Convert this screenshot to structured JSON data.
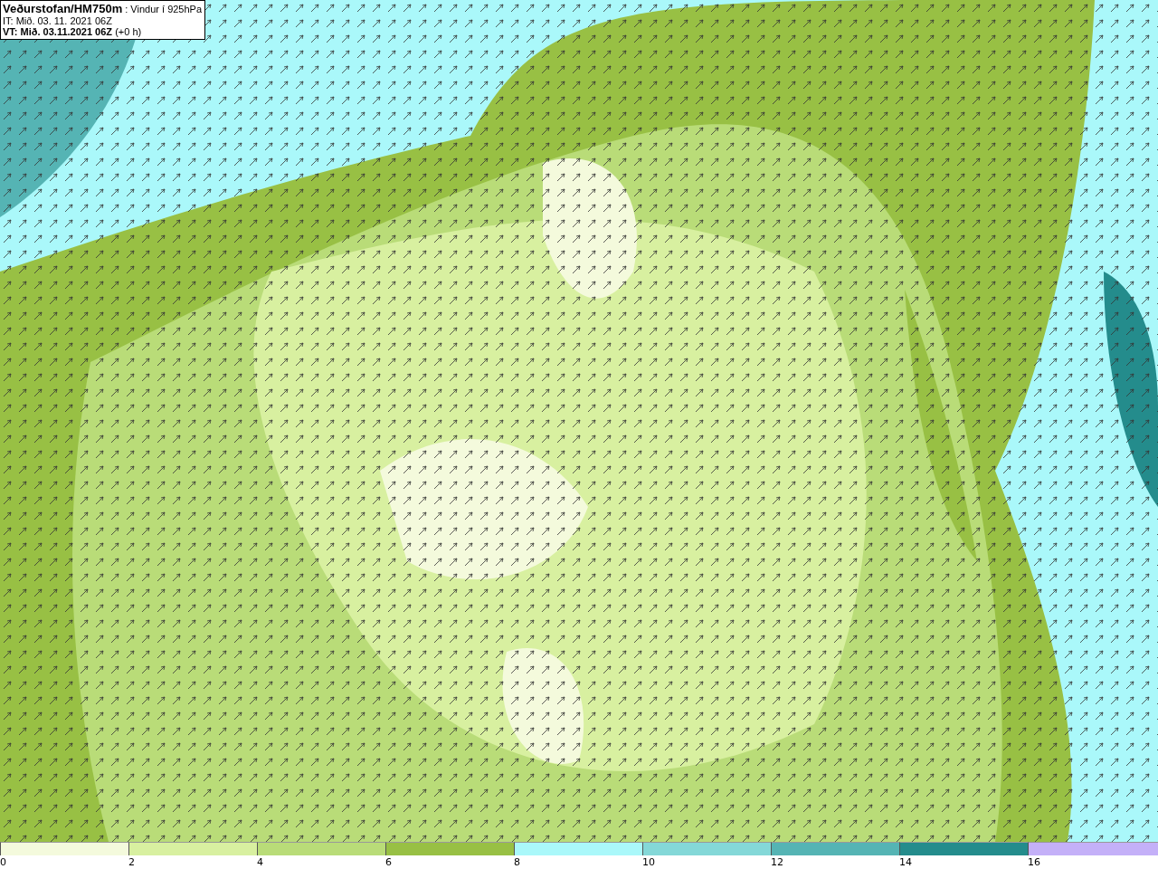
{
  "map": {
    "title": "**Veðurstofan/HM750m** : Vindur í 925hPa",
    "lines": [
      "IT: Mið. 03. 11. 2021 06Z",
      "**VT: Mið. 03.11.2021 06Z** (+0 h)"
    ]
  },
  "legend": {
    "bins": [
      {
        "label": "0",
        "color": "#f4fadc"
      },
      {
        "label": "2",
        "color": "#d8f0a0"
      },
      {
        "label": "4",
        "color": "#b9dc78"
      },
      {
        "label": "6",
        "color": "#98c044"
      },
      {
        "label": "8",
        "color": "#aaf8fa"
      },
      {
        "label": "10",
        "color": "#84d8d8"
      },
      {
        "label": "12",
        "color": "#55b4b4"
      },
      {
        "label": "14",
        "color": "#248c8c"
      },
      {
        "label": "16",
        "color": "#c4b0f8"
      }
    ]
  }
}
